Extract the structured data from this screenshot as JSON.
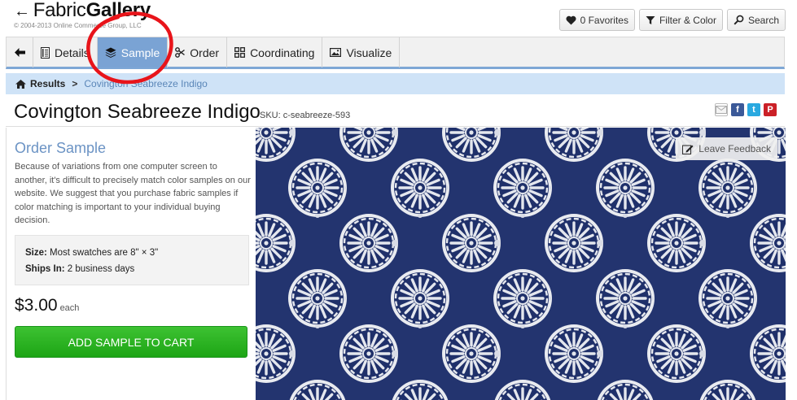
{
  "logo": {
    "arrow": "←",
    "brand_regular": "Fabric",
    "brand_bold": "Gallery",
    "copyright": "© 2004-2013 Online Commerce Group, LLC"
  },
  "header_buttons": {
    "favorites": "0 Favorites",
    "filter": "Filter & Color",
    "search": "Search"
  },
  "tabs": {
    "details": "Details",
    "sample": "Sample",
    "order": "Order",
    "coordinating": "Coordinating",
    "visualize": "Visualize"
  },
  "breadcrumb": {
    "results": "Results",
    "separator": ">",
    "current": "Covington Seabreeze Indigo"
  },
  "product": {
    "title": "Covington Seabreeze Indigo",
    "sku": "SKU: c-seabreeze-593"
  },
  "share": {
    "facebook": "f",
    "twitter": "t",
    "pinterest": "P"
  },
  "order_sample": {
    "heading": "Order Sample",
    "description": "Because of variations from one computer screen to another, it's difficult to precisely match color samples on our website. We suggest that you purchase fabric samples if color matching is important to your individual buying decision.",
    "size_label": "Size:",
    "size_value": "Most swatches are 8\" × 3\"",
    "ships_label": "Ships In:",
    "ships_value": "2 business days",
    "price": "$3.00",
    "price_unit": "each",
    "add_button": "ADD SAMPLE TO CART"
  },
  "fabric": {
    "feedback_label": "Leave Feedback"
  },
  "colors": {
    "tab_active": "#7aa3d4",
    "breadcrumb_bg": "#cfe3f7",
    "accent_text": "#6b93c4",
    "add_button": "#22a91a",
    "fabric_navy": "#1e2f6b",
    "annotation": "#e8141a"
  }
}
